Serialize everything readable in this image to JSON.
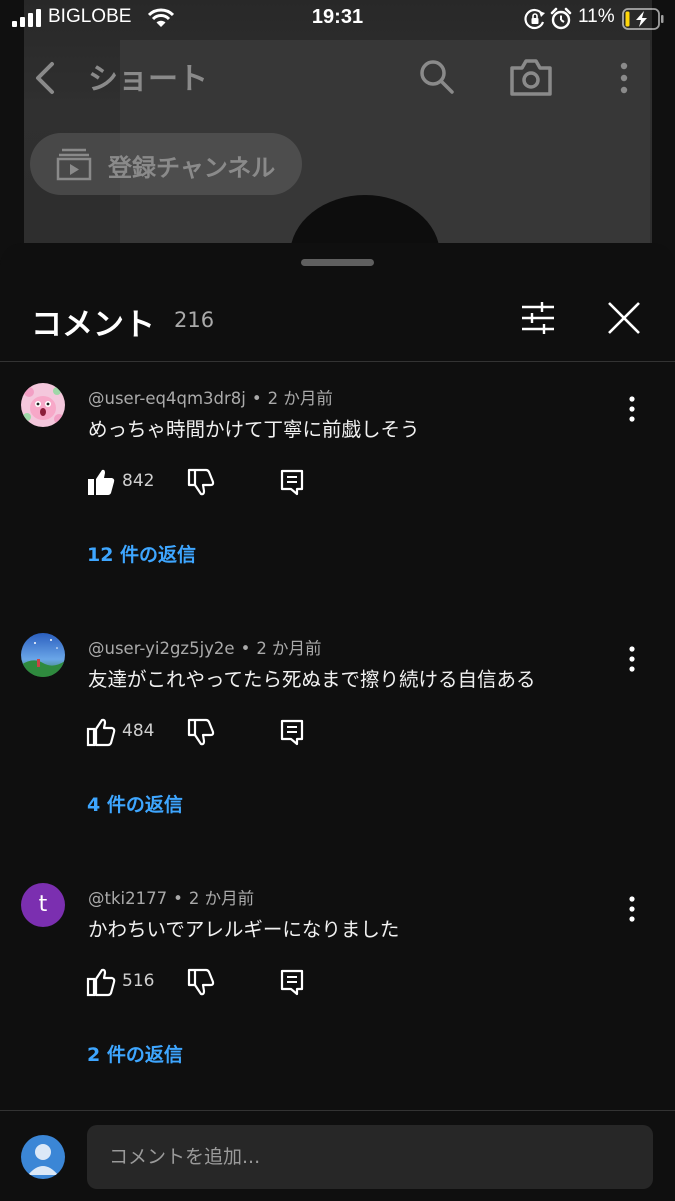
{
  "status_bar": {
    "carrier": "BIGLOBE",
    "time": "19:31",
    "battery": "11%"
  },
  "background_page": {
    "title": "ショート",
    "chip_label": "登録チャンネル"
  },
  "comments_panel": {
    "title": "コメント",
    "count": "216"
  },
  "comments": [
    {
      "author": "@user-eq4qm3dr8j",
      "separator": "•",
      "time": "2 か月前",
      "text": "めっちゃ時間かけて丁寧に前戯しそう",
      "likes": "842",
      "liked": true,
      "replies": "12 件の返信"
    },
    {
      "author": "@user-yi2gz5jy2e",
      "separator": "•",
      "time": "2 か月前",
      "text": "友達がこれやってたら死ぬまで擦り続ける自信ある",
      "likes": "484",
      "liked": false,
      "replies": "4 件の返信"
    },
    {
      "author": "@tki2177",
      "separator": "•",
      "time": "2 か月前",
      "text": "かわちいでアレルギーになりました",
      "likes": "516",
      "liked": false,
      "replies": "2 件の返信",
      "avatar_letter": "t"
    }
  ],
  "composer": {
    "placeholder": "コメントを追加..."
  },
  "colors": {
    "background": "#0f0f0f",
    "link": "#3ea6ff",
    "secondary_text": "#aaaaaa",
    "avatar_purple": "#7b2fb0"
  }
}
